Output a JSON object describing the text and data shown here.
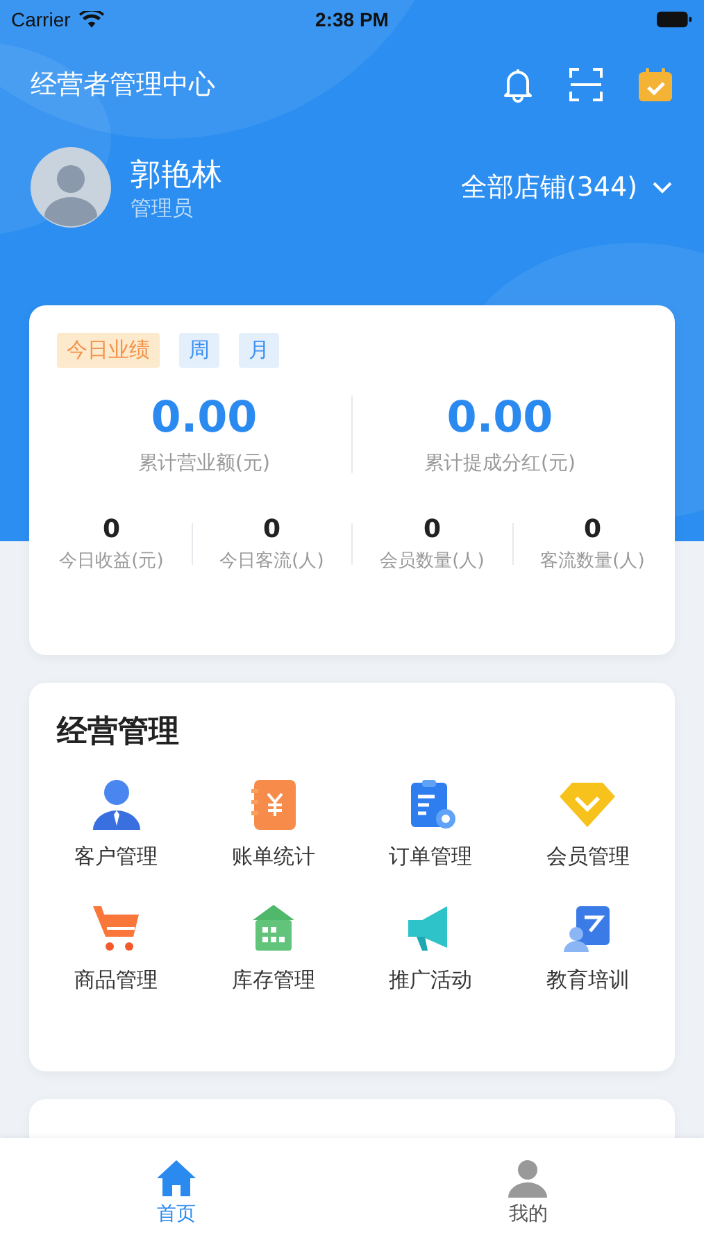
{
  "status_bar": {
    "carrier": "Carrier",
    "time": "2:38 PM"
  },
  "header": {
    "title": "经营者管理中心"
  },
  "user": {
    "name": "郭艳林",
    "role": "管理员",
    "store_selector": "全部店铺(344)"
  },
  "summary": {
    "periods": [
      {
        "label": "今日业绩",
        "selected": true
      },
      {
        "label": "周",
        "selected": false
      },
      {
        "label": "月",
        "selected": false
      }
    ],
    "totals": [
      {
        "value": "0.00",
        "label": "累计营业额(元)"
      },
      {
        "value": "0.00",
        "label": "累计提成分红(元)"
      }
    ],
    "stats": [
      {
        "value": "0",
        "label": "今日收益(元)"
      },
      {
        "value": "0",
        "label": "今日客流(人)"
      },
      {
        "value": "0",
        "label": "会员数量(人)"
      },
      {
        "value": "0",
        "label": "客流数量(人)"
      }
    ]
  },
  "business": {
    "title": "经营管理",
    "items": [
      {
        "label": "客户管理"
      },
      {
        "label": "账单统计"
      },
      {
        "label": "订单管理"
      },
      {
        "label": "会员管理"
      },
      {
        "label": "商品管理"
      },
      {
        "label": "库存管理"
      },
      {
        "label": "推广活动"
      },
      {
        "label": "教育培训"
      }
    ]
  },
  "tab_bar": [
    {
      "label": "首页",
      "selected": true
    },
    {
      "label": "我的",
      "selected": false
    }
  ]
}
